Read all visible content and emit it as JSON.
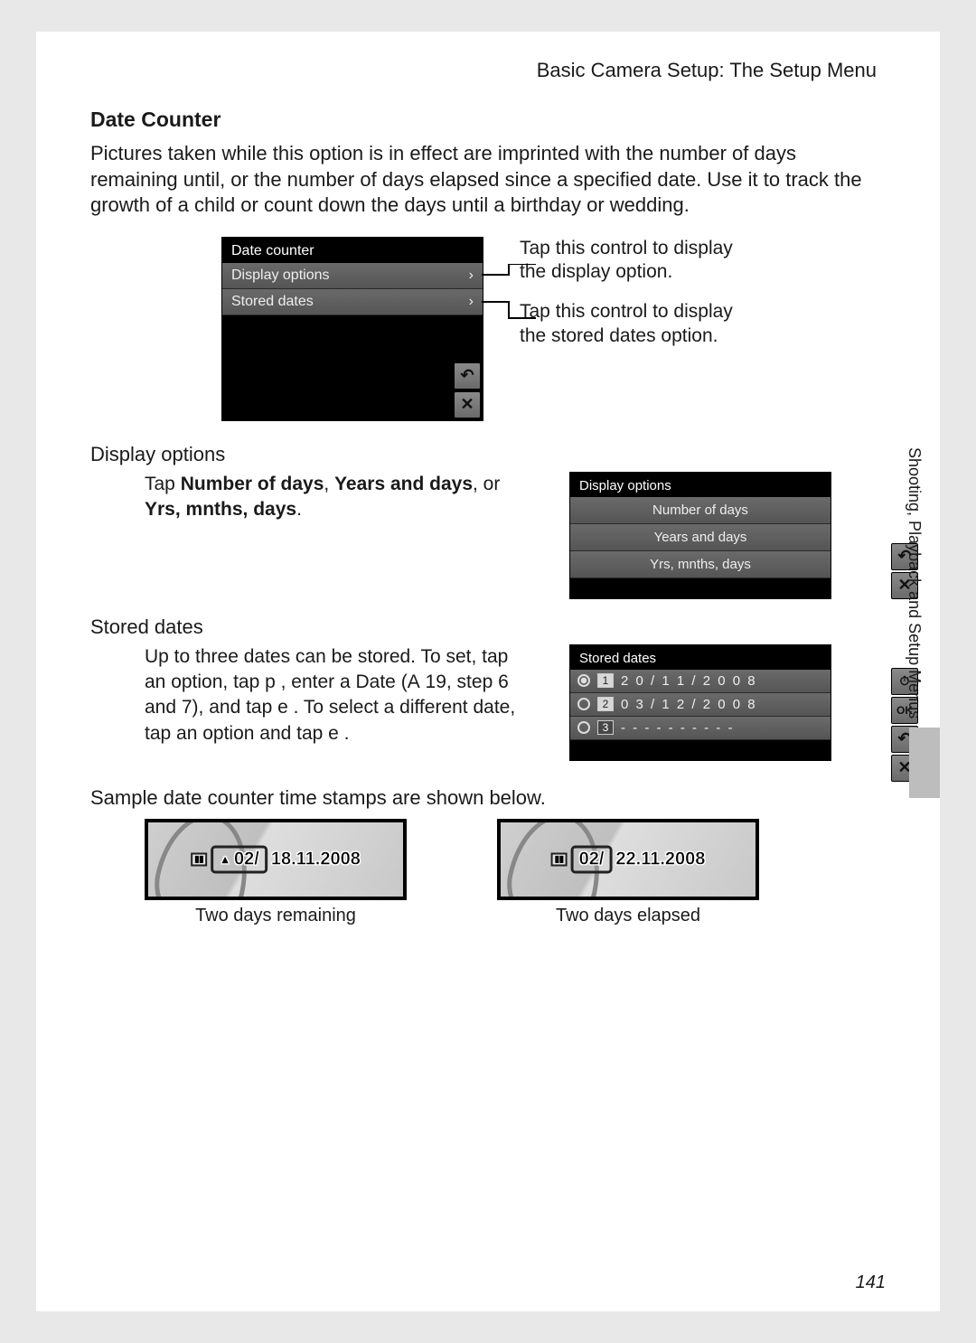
{
  "header": "Basic Camera Setup: The Setup Menu",
  "title": "Date Counter",
  "intro": "Pictures taken while this option is in effect are imprinted with the number of days remaining until, or the number of days elapsed since a specified date. Use it to track the growth of a child or count down the days until a birthday or wedding.",
  "menu1": {
    "title": "Date counter",
    "items": [
      "Display options",
      "Stored dates"
    ]
  },
  "callout_display": "Tap this control to display the display option.",
  "callout_stored": "Tap this control to display the stored dates option.",
  "sub_display": "Display options",
  "display_instr_pre": "Tap ",
  "display_instr_b1": "Number of days",
  "display_instr_mid1": ", ",
  "display_instr_b2": "Years and days",
  "display_instr_mid2": ", or ",
  "display_instr_b3": "Yrs, mnths, days",
  "display_instr_end": ".",
  "display_menu": {
    "title": "Display options",
    "items": [
      "Number of days",
      "Years and days",
      "Yrs, mnths, days"
    ]
  },
  "sub_stored": "Stored dates",
  "stored_instr": "Up to three dates can be stored. To set, tap an option, tap p , enter a Date (A 19, step 6 and 7), and tap e . To select a different date, tap an option and tap e .",
  "stored_menu": {
    "title": "Stored dates",
    "rows": [
      {
        "num": "1",
        "value": "2 0 / 1 1 / 2 0 0 8",
        "selected": true
      },
      {
        "num": "2",
        "value": "0 3 / 1 2 / 2 0 0 8",
        "selected": false
      },
      {
        "num": "3",
        "value": "- - - - - - - - - -",
        "selected": false
      }
    ]
  },
  "sample_line": "Sample date counter time stamps are shown below.",
  "samples": [
    {
      "stamp_arrow": "▲",
      "stamp_num": "02/",
      "stamp_date": "18.11.2008",
      "caption": "Two days remaining"
    },
    {
      "stamp_arrow": "",
      "stamp_num": "02/",
      "stamp_date": "22.11.2008",
      "caption": "Two days elapsed"
    }
  ],
  "side_label": "Shooting, Playback and Setup Menus",
  "page_number": "141",
  "icons": {
    "back": "↶",
    "close": "✕",
    "clock": "⏱",
    "ok": "OK"
  }
}
